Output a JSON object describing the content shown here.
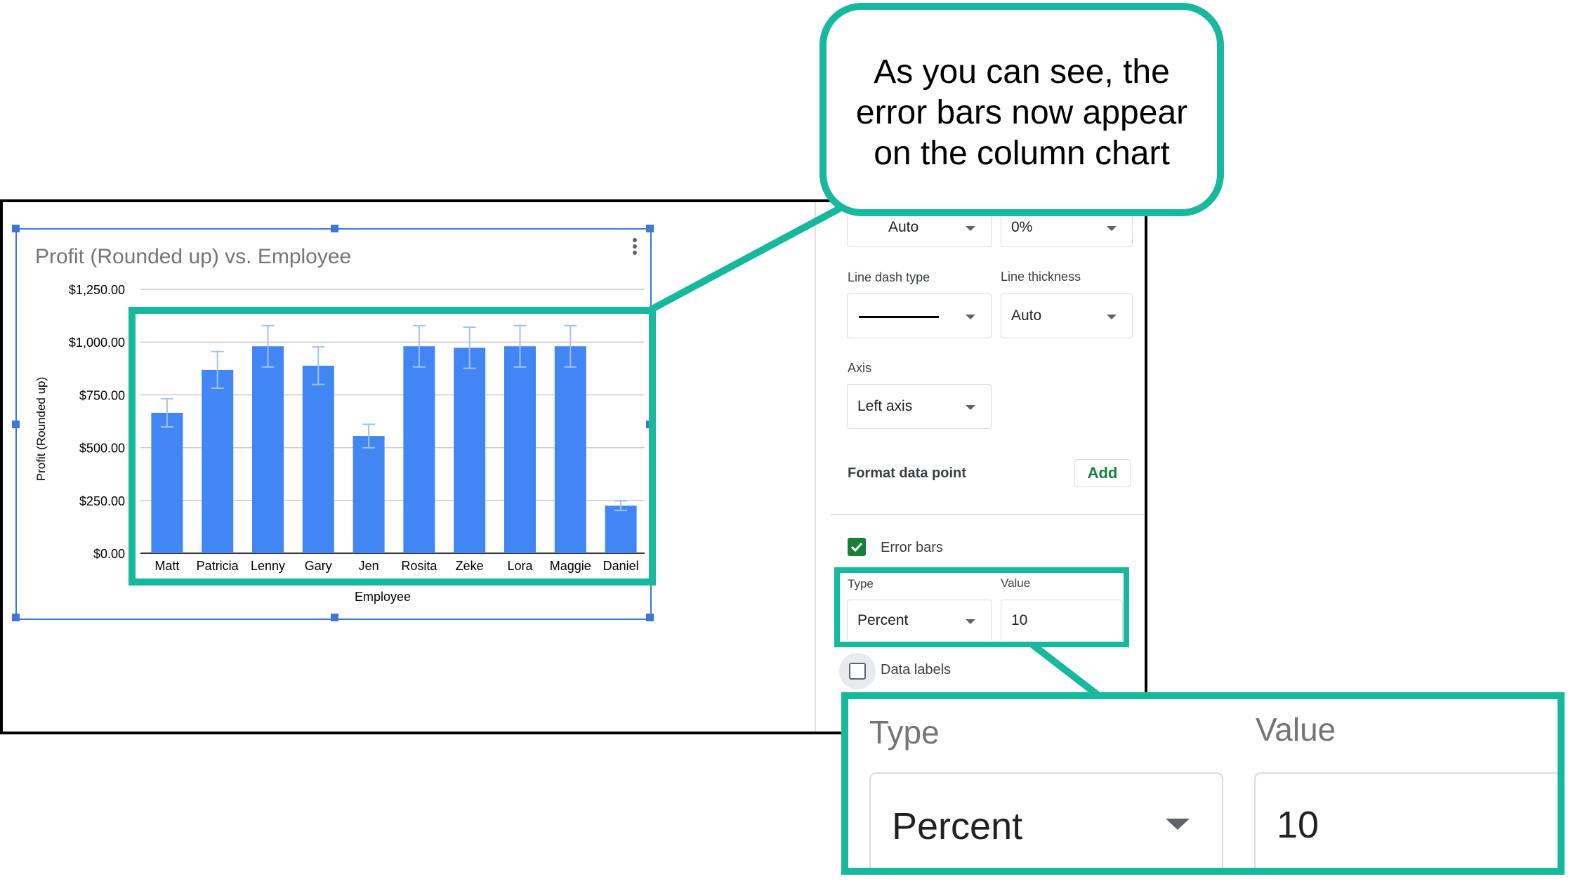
{
  "callout": {
    "line1": "As you can see, the",
    "line2": "error bars now appear",
    "line3": "on the column chart"
  },
  "chart": {
    "title": "Profit (Rounded up) vs. Employee",
    "menu_icon": "more-vert-icon"
  },
  "chart_data": {
    "type": "bar",
    "title": "Profit (Rounded up) vs. Employee",
    "xlabel": "Employee",
    "ylabel": "Profit (Rounded up)",
    "ylim": [
      0,
      1250
    ],
    "ytick_values": [
      0,
      250,
      500,
      750,
      1000,
      1250
    ],
    "yticks": [
      "$0.00",
      "$250.00",
      "$500.00",
      "$750.00",
      "$1,000.00",
      "$1,250.00"
    ],
    "categories": [
      "Matt",
      "Patricia",
      "Lenny",
      "Gary",
      "Jen",
      "Rosita",
      "Zeke",
      "Lora",
      "Maggie",
      "Daniel"
    ],
    "values": [
      665,
      868,
      980,
      888,
      555,
      980,
      973,
      980,
      980,
      225
    ],
    "error_bars": {
      "type": "Percent",
      "value": 10
    },
    "grid": true,
    "bar_color": "#4285f4",
    "error_bar_color": "#9fc3f7"
  },
  "sidebar": {
    "top_left_select": "Auto",
    "top_right_select": "0%",
    "line_dash_label": "Line dash type",
    "line_thickness_label": "Line thickness",
    "line_thickness_value": "Auto",
    "axis_label": "Axis",
    "axis_value": "Left axis",
    "format_point_label": "Format data point",
    "add_button": "Add",
    "error_bars_label": "Error bars",
    "error_bars_checked": true,
    "type_label": "Type",
    "value_label": "Value",
    "type_value": "Percent",
    "value_value": "10",
    "data_labels_label": "Data labels",
    "data_labels_checked": false
  },
  "zoom": {
    "type_label": "Type",
    "value_label": "Value",
    "type_value": "Percent",
    "value_value": "10"
  },
  "colors": {
    "accent": "#16b99d",
    "checkbox": "#188038",
    "add_text": "#188038"
  }
}
